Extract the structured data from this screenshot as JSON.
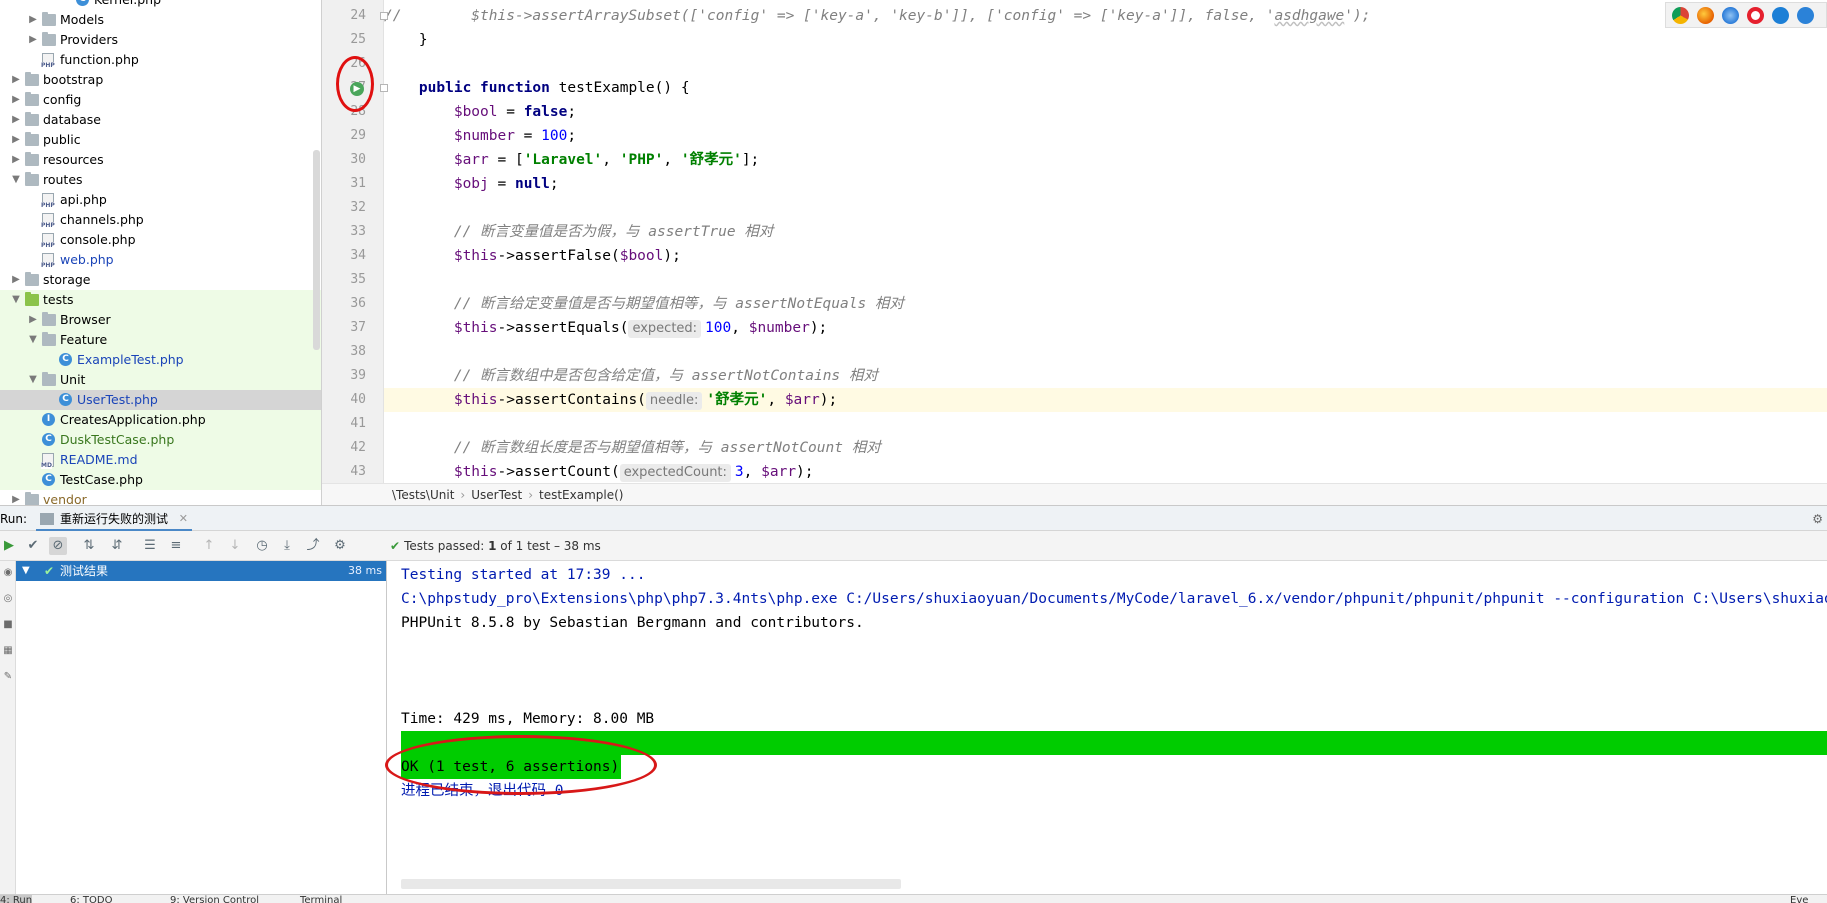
{
  "project_tree": [
    {
      "label": "Kernel.php",
      "type": "class",
      "indent": 4,
      "arrow": "",
      "style": ""
    },
    {
      "label": "Models",
      "type": "folder",
      "indent": 2,
      "arrow": "right",
      "style": ""
    },
    {
      "label": "Providers",
      "type": "folder",
      "indent": 2,
      "arrow": "right",
      "style": ""
    },
    {
      "label": "function.php",
      "type": "php",
      "indent": 2,
      "arrow": "",
      "style": ""
    },
    {
      "label": "bootstrap",
      "type": "folder",
      "indent": 1,
      "arrow": "right",
      "style": ""
    },
    {
      "label": "config",
      "type": "folder",
      "indent": 1,
      "arrow": "right",
      "style": ""
    },
    {
      "label": "database",
      "type": "folder",
      "indent": 1,
      "arrow": "right",
      "style": ""
    },
    {
      "label": "public",
      "type": "folder",
      "indent": 1,
      "arrow": "right",
      "style": ""
    },
    {
      "label": "resources",
      "type": "folder",
      "indent": 1,
      "arrow": "right",
      "style": ""
    },
    {
      "label": "routes",
      "type": "folder",
      "indent": 1,
      "arrow": "down",
      "style": ""
    },
    {
      "label": "api.php",
      "type": "php",
      "indent": 2,
      "arrow": "",
      "style": ""
    },
    {
      "label": "channels.php",
      "type": "php",
      "indent": 2,
      "arrow": "",
      "style": ""
    },
    {
      "label": "console.php",
      "type": "php",
      "indent": 2,
      "arrow": "",
      "style": ""
    },
    {
      "label": "web.php",
      "type": "php",
      "indent": 2,
      "arrow": "",
      "style": "blue"
    },
    {
      "label": "storage",
      "type": "folder",
      "indent": 1,
      "arrow": "right",
      "style": ""
    },
    {
      "label": "tests",
      "type": "folder-green",
      "indent": 1,
      "arrow": "down",
      "style": "green-row"
    },
    {
      "label": "Browser",
      "type": "folder",
      "indent": 2,
      "arrow": "right",
      "style": "green-row"
    },
    {
      "label": "Feature",
      "type": "folder",
      "indent": 2,
      "arrow": "down",
      "style": "green-row"
    },
    {
      "label": "ExampleTest.php",
      "type": "class",
      "indent": 3,
      "arrow": "",
      "style": "green-row blue"
    },
    {
      "label": "Unit",
      "type": "folder",
      "indent": 2,
      "arrow": "down",
      "style": "green-row"
    },
    {
      "label": "UserTest.php",
      "type": "class",
      "indent": 3,
      "arrow": "",
      "style": "selected blue"
    },
    {
      "label": "CreatesApplication.php",
      "type": "interface",
      "indent": 2,
      "arrow": "",
      "style": "green-row"
    },
    {
      "label": "DuskTestCase.php",
      "type": "class",
      "indent": 2,
      "arrow": "",
      "style": "green-row green"
    },
    {
      "label": "README.md",
      "type": "md",
      "indent": 2,
      "arrow": "",
      "style": "green-row blue"
    },
    {
      "label": "TestCase.php",
      "type": "class",
      "indent": 2,
      "arrow": "",
      "style": "green-row"
    },
    {
      "label": "vendor",
      "type": "folder",
      "indent": 1,
      "arrow": "right",
      "style": "vendor"
    }
  ],
  "editor": {
    "line_numbers": [
      "24",
      "25",
      "26",
      "27",
      "28",
      "29",
      "30",
      "31",
      "32",
      "33",
      "34",
      "35",
      "36",
      "37",
      "38",
      "39",
      "40",
      "41",
      "42",
      "43"
    ],
    "lines": [
      [
        {
          "t": "//        $this->assertArraySubset(['config' => ['key-a', 'key-b']], ['config' => ['key-a']], false, '",
          "c": "cmt"
        },
        {
          "t": "asdhgawe",
          "c": "cmt u-squig"
        },
        {
          "t": "');",
          "c": "cmt"
        }
      ],
      [
        {
          "t": "    }",
          "c": ""
        }
      ],
      [
        {
          "t": "",
          "c": ""
        }
      ],
      [
        {
          "t": "    ",
          "c": ""
        },
        {
          "t": "public function ",
          "c": "kw"
        },
        {
          "t": "testExample() {",
          "c": ""
        }
      ],
      [
        {
          "t": "        ",
          "c": ""
        },
        {
          "t": "$bool",
          "c": "var"
        },
        {
          "t": " = ",
          "c": ""
        },
        {
          "t": "false",
          "c": "kw"
        },
        {
          "t": ";",
          "c": ""
        }
      ],
      [
        {
          "t": "        ",
          "c": ""
        },
        {
          "t": "$number",
          "c": "var"
        },
        {
          "t": " = ",
          "c": ""
        },
        {
          "t": "100",
          "c": "num"
        },
        {
          "t": ";",
          "c": ""
        }
      ],
      [
        {
          "t": "        ",
          "c": ""
        },
        {
          "t": "$arr",
          "c": "var"
        },
        {
          "t": " = [",
          "c": ""
        },
        {
          "t": "'Laravel'",
          "c": "str"
        },
        {
          "t": ", ",
          "c": ""
        },
        {
          "t": "'PHP'",
          "c": "str"
        },
        {
          "t": ", ",
          "c": ""
        },
        {
          "t": "'舒孝元'",
          "c": "str"
        },
        {
          "t": "];",
          "c": ""
        }
      ],
      [
        {
          "t": "        ",
          "c": ""
        },
        {
          "t": "$obj",
          "c": "var"
        },
        {
          "t": " = ",
          "c": ""
        },
        {
          "t": "null",
          "c": "kw"
        },
        {
          "t": ";",
          "c": ""
        }
      ],
      [
        {
          "t": "",
          "c": ""
        }
      ],
      [
        {
          "t": "        // 断言变量值是否为假，与 assertTrue 相对",
          "c": "cmt"
        }
      ],
      [
        {
          "t": "        ",
          "c": ""
        },
        {
          "t": "$this",
          "c": "var"
        },
        {
          "t": "->assertFalse(",
          "c": ""
        },
        {
          "t": "$bool",
          "c": "var"
        },
        {
          "t": ");",
          "c": ""
        }
      ],
      [
        {
          "t": "",
          "c": ""
        }
      ],
      [
        {
          "t": "        // 断言给定变量值是否与期望值相等，与 assertNotEquals 相对",
          "c": "cmt"
        }
      ],
      [
        {
          "t": "        ",
          "c": ""
        },
        {
          "t": "$this",
          "c": "var"
        },
        {
          "t": "->assertEquals(",
          "c": ""
        },
        {
          "t": "expected:",
          "c": "hint"
        },
        {
          "t": "100",
          "c": "num"
        },
        {
          "t": ", ",
          "c": ""
        },
        {
          "t": "$number",
          "c": "var"
        },
        {
          "t": ");",
          "c": ""
        }
      ],
      [
        {
          "t": "",
          "c": ""
        }
      ],
      [
        {
          "t": "        // 断言数组中是否包含给定值，与 assertNotContains 相对",
          "c": "cmt"
        }
      ],
      [
        {
          "t": "        ",
          "c": ""
        },
        {
          "t": "$this",
          "c": "var"
        },
        {
          "t": "->assertContains(",
          "c": ""
        },
        {
          "t": "needle:",
          "c": "hint"
        },
        {
          "t": "'舒孝元'",
          "c": "str"
        },
        {
          "t": ", ",
          "c": ""
        },
        {
          "t": "$arr",
          "c": "var"
        },
        {
          "t": ");",
          "c": ""
        }
      ],
      [
        {
          "t": "",
          "c": ""
        }
      ],
      [
        {
          "t": "        // 断言数组长度是否与期望值相等，与 assertNotCount 相对",
          "c": "cmt"
        }
      ],
      [
        {
          "t": "        ",
          "c": ""
        },
        {
          "t": "$this",
          "c": "var"
        },
        {
          "t": "->assertCount(",
          "c": ""
        },
        {
          "t": "expectedCount:",
          "c": "hint"
        },
        {
          "t": "3",
          "c": "num"
        },
        {
          "t": ", ",
          "c": ""
        },
        {
          "t": "$arr",
          "c": "var"
        },
        {
          "t": ");",
          "c": ""
        }
      ]
    ],
    "highlighted_line": "40"
  },
  "breadcrumb": {
    "items": [
      "\\Tests\\Unit",
      "UserTest",
      "testExample()"
    ]
  },
  "run_panel": {
    "label": "Run:",
    "tab_label": "重新运行失败的测试",
    "status_prefix": "Tests passed: ",
    "status_count": "1",
    "status_suffix": " of 1 test – 38 ms",
    "result_label": "测试结果",
    "result_time": "38 ms"
  },
  "console": {
    "lines": [
      {
        "text": "Testing started at 17:39 ...",
        "color": "blue"
      },
      {
        "text": "C:\\phpstudy_pro\\Extensions\\php\\php7.3.4nts\\php.exe C:/Users/shuxiaoyuan/Documents/MyCode/laravel_6.x/vendor/phpunit/phpunit/phpunit --configuration C:\\Users\\shuxiaoyuan\\Docu",
        "color": "blue"
      },
      {
        "text": "PHPUnit 8.5.8 by Sebastian Bergmann and contributors.",
        "color": "black"
      },
      {
        "text": "",
        "color": "black"
      },
      {
        "text": "",
        "color": "black"
      },
      {
        "text": "",
        "color": "black"
      },
      {
        "text": "Time: 429 ms, Memory: 8.00 MB",
        "color": "black"
      }
    ],
    "ok_text": "OK (1 test, 6 assertions)",
    "exit_text": "进程已结束，退出代码 0"
  },
  "bottom_bar": {
    "items": [
      "4: Run",
      "6: TODO",
      "9: Version Control",
      "Terminal"
    ],
    "right_text": "Eve"
  },
  "colors": {
    "accent": "#4a88c7",
    "pass_green": "#00cc00",
    "annotation_red": "#e01010"
  }
}
